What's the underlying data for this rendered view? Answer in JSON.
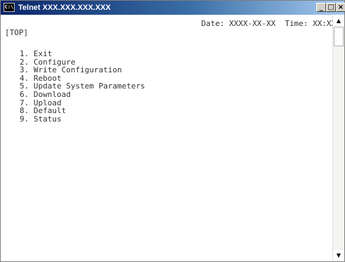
{
  "window": {
    "title": "Telnet XXX.XXX.XXX.XXX",
    "icon": "console-icon",
    "icon_label": "C:\\",
    "buttons": {
      "minimize": "_",
      "maximize": "□",
      "close": "×"
    }
  },
  "console": {
    "date_line": "Date: XXXX-XX-XX  Time: XX:XX:XX",
    "section": "[TOP]",
    "menu": [
      "1. Exit",
      "2. Configure",
      "3. Write Configuration",
      "4. Reboot",
      "5. Update System Parameters",
      "6. Download",
      "7. Upload",
      "8. Default",
      "9. Status"
    ]
  },
  "scrollbar": {
    "up_arrow": "▲",
    "down_arrow": "▼"
  }
}
